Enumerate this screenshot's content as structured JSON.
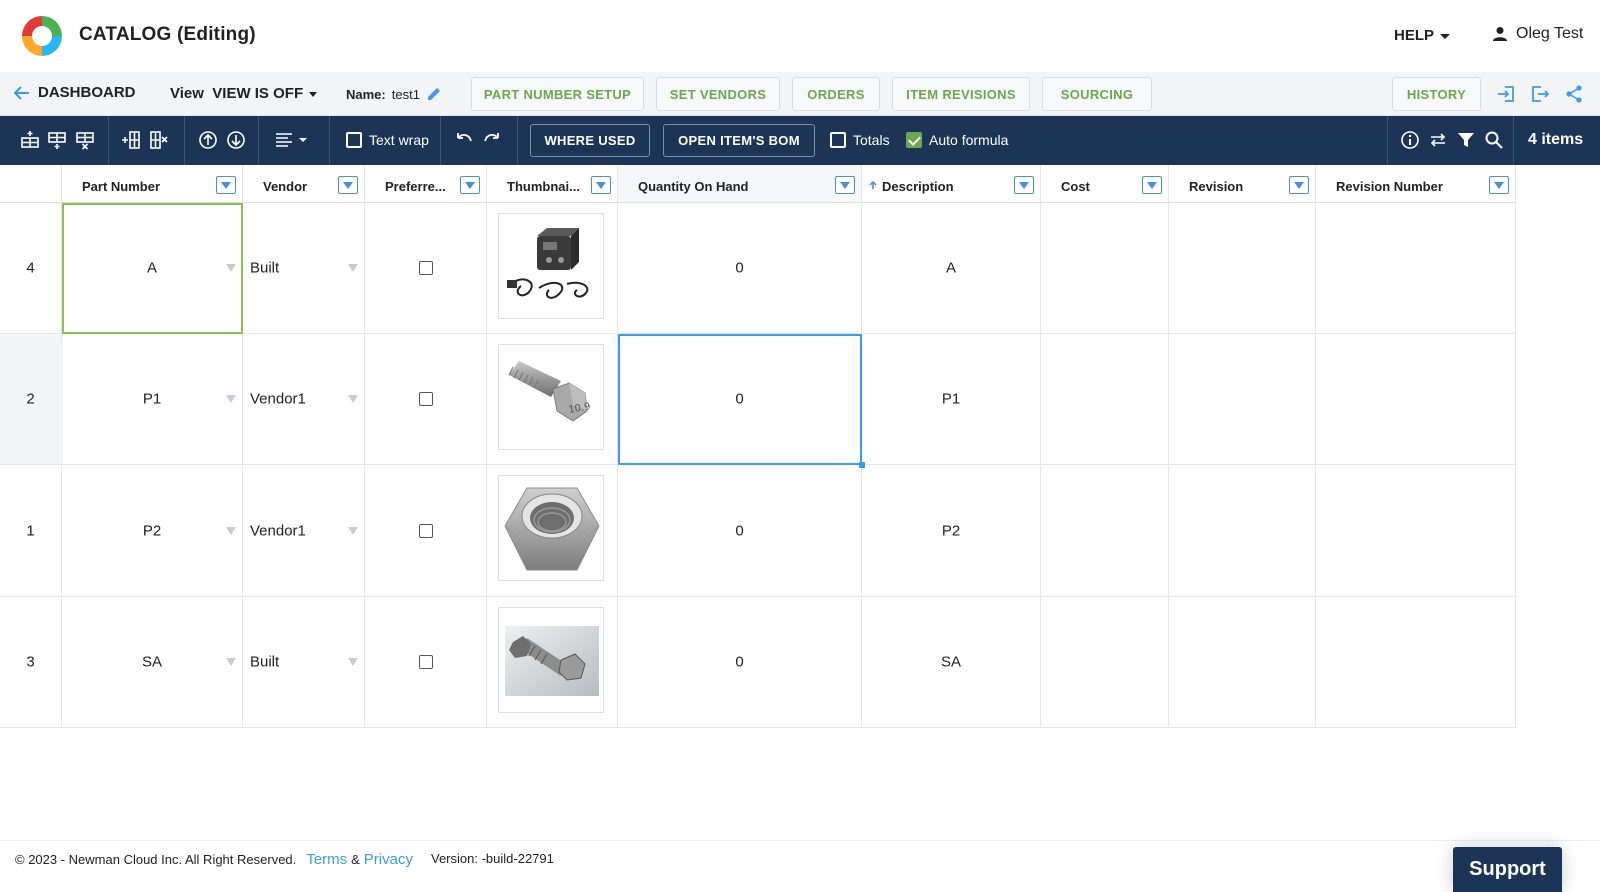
{
  "header": {
    "title": "CATALOG (Editing)",
    "help_label": "HELP",
    "user_name": "Oleg Test"
  },
  "nav": {
    "back_label": "DASHBOARD",
    "view_prefix": "View",
    "view_value": "VIEW IS OFF",
    "name_label": "Name:",
    "name_value": "test1",
    "buttons": [
      "PART NUMBER SETUP",
      "SET VENDORS",
      "ORDERS",
      "ITEM REVISIONS",
      "SOURCING"
    ],
    "history_label": "HISTORY"
  },
  "toolbar": {
    "text_wrap_label": "Text wrap",
    "text_wrap_checked": false,
    "where_used_label": "WHERE USED",
    "open_bom_label": "OPEN ITEM'S BOM",
    "totals_label": "Totals",
    "totals_checked": false,
    "auto_formula_label": "Auto formula",
    "auto_formula_checked": true,
    "items_count": "4 items"
  },
  "table": {
    "columns": [
      "Part Number",
      "Vendor",
      "Preferre...",
      "Thumbnai...",
      "Quantity On Hand",
      "Description",
      "Cost",
      "Revision",
      "Revision Number"
    ],
    "sort": {
      "column": "Description",
      "direction": "asc"
    },
    "rows": [
      {
        "id": "4",
        "part_number": "A",
        "vendor": "Built",
        "preferred": false,
        "thumbnail": "welder-machine",
        "qty": "0",
        "description": "A",
        "cost": "",
        "revision": "",
        "revision_number": ""
      },
      {
        "id": "2",
        "part_number": "P1",
        "vendor": "Vendor1",
        "preferred": false,
        "thumbnail": "hex-bolt",
        "qty": "0",
        "description": "P1",
        "cost": "",
        "revision": "",
        "revision_number": ""
      },
      {
        "id": "1",
        "part_number": "P2",
        "vendor": "Vendor1",
        "preferred": false,
        "thumbnail": "hex-nut",
        "qty": "0",
        "description": "P2",
        "cost": "",
        "revision": "",
        "revision_number": ""
      },
      {
        "id": "3",
        "part_number": "SA",
        "vendor": "Built",
        "preferred": false,
        "thumbnail": "bolt-assembly",
        "qty": "0",
        "description": "SA",
        "cost": "",
        "revision": "",
        "revision_number": ""
      }
    ]
  },
  "footer": {
    "copyright": "© 2023 - Newman Cloud Inc. All Right Reserved.",
    "terms": "Terms",
    "amp": "&",
    "privacy": "Privacy",
    "version": "Version: -build-22791",
    "support_label": "Support"
  },
  "colors": {
    "toolbar_bg": "#1c3557",
    "accent_green": "#6aa84f",
    "accent_blue": "#3d9be9"
  }
}
